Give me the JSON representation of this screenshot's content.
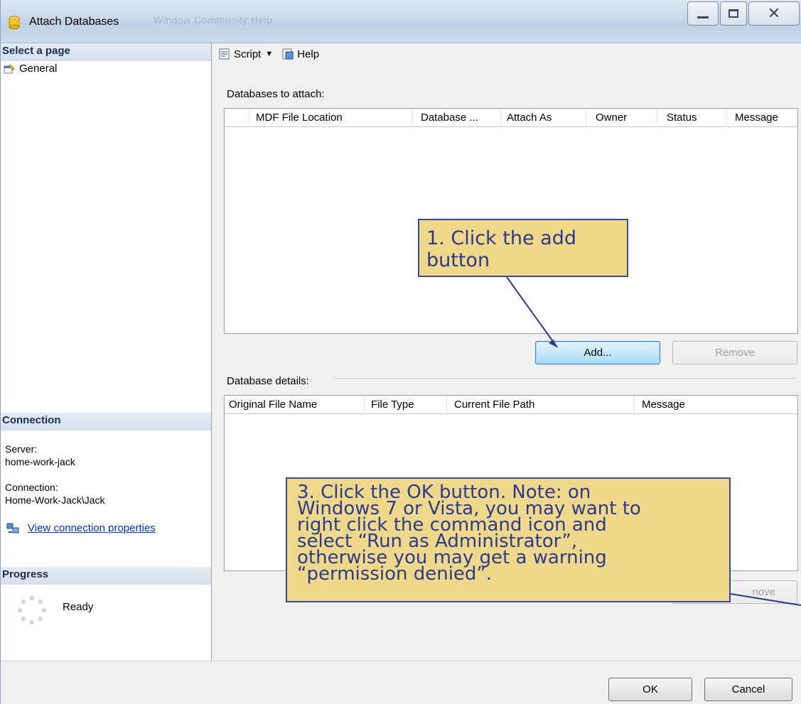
{
  "window": {
    "title": "Attach Databases",
    "ghost_menu": "Window   Community   Help"
  },
  "left": {
    "select_page_header": "Select a page",
    "pages": [
      {
        "label": "General"
      }
    ],
    "connection_header": "Connection",
    "server_label": "Server:",
    "server_value": "home-work-jack",
    "connection_label": "Connection:",
    "connection_value": "Home-Work-Jack\\Jack",
    "view_props_link": "View connection properties",
    "progress_header": "Progress",
    "progress_status": "Ready"
  },
  "toolbar": {
    "script_label": "Script",
    "help_label": "Help"
  },
  "attach": {
    "label": "Databases to attach:",
    "columns": [
      "MDF File Location",
      "Database ...",
      "Attach As",
      "Owner",
      "Status",
      "Message"
    ],
    "add_button": "Add...",
    "remove_button": "Remove"
  },
  "details": {
    "label": "Database details:",
    "columns": [
      "Original File Name",
      "File Type",
      "Current File Path",
      "Message"
    ],
    "remove_button_partial": "nove"
  },
  "footer": {
    "ok_button": "OK",
    "cancel_button": "Cancel"
  },
  "callouts": {
    "step1": "1. Click the add button",
    "step3_lines": [
      "3. Click the OK button. Note: on",
      "Windows 7 or Vista, you may want to",
      "right click the command icon and",
      "select “Run as Administrator”,",
      "otherwise you may get a warning",
      "“permission denied”."
    ]
  }
}
